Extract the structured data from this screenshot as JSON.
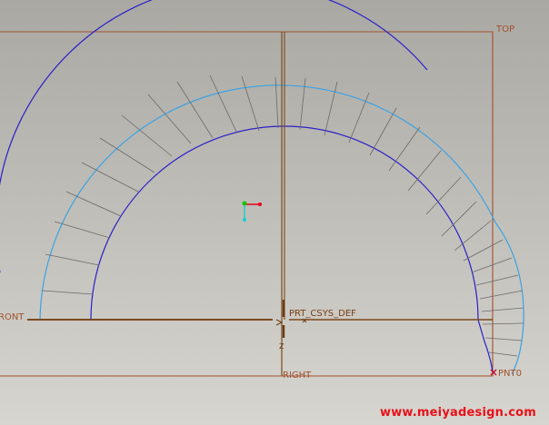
{
  "viewport": {
    "datum_planes": {
      "top": "TOP",
      "front": "RONT",
      "right": "RIGHT"
    },
    "coordinate_system": {
      "label": "PRT_CSYS_DEF",
      "z_axis_label": "Z"
    },
    "datum_point": {
      "label": "PNT0"
    },
    "colors": {
      "datum_plane": "#a0522d",
      "datum_axis": "#7a4a1f",
      "curve": "#2a21c8",
      "surface_edge": "#3aa2e6",
      "mesh_line": "#6a6a6a",
      "spin_center_x": "#e8001c",
      "spin_center_y": "#16c400",
      "spin_center_z": "#14d0d0",
      "datum_point": "#c0002a"
    },
    "icons": {
      "spin_center": "spin-center-icon",
      "csys_origin": "csys-origin-icon",
      "datum_point": "datum-point-x-icon"
    }
  },
  "watermark": "www.meiyadesign.com"
}
